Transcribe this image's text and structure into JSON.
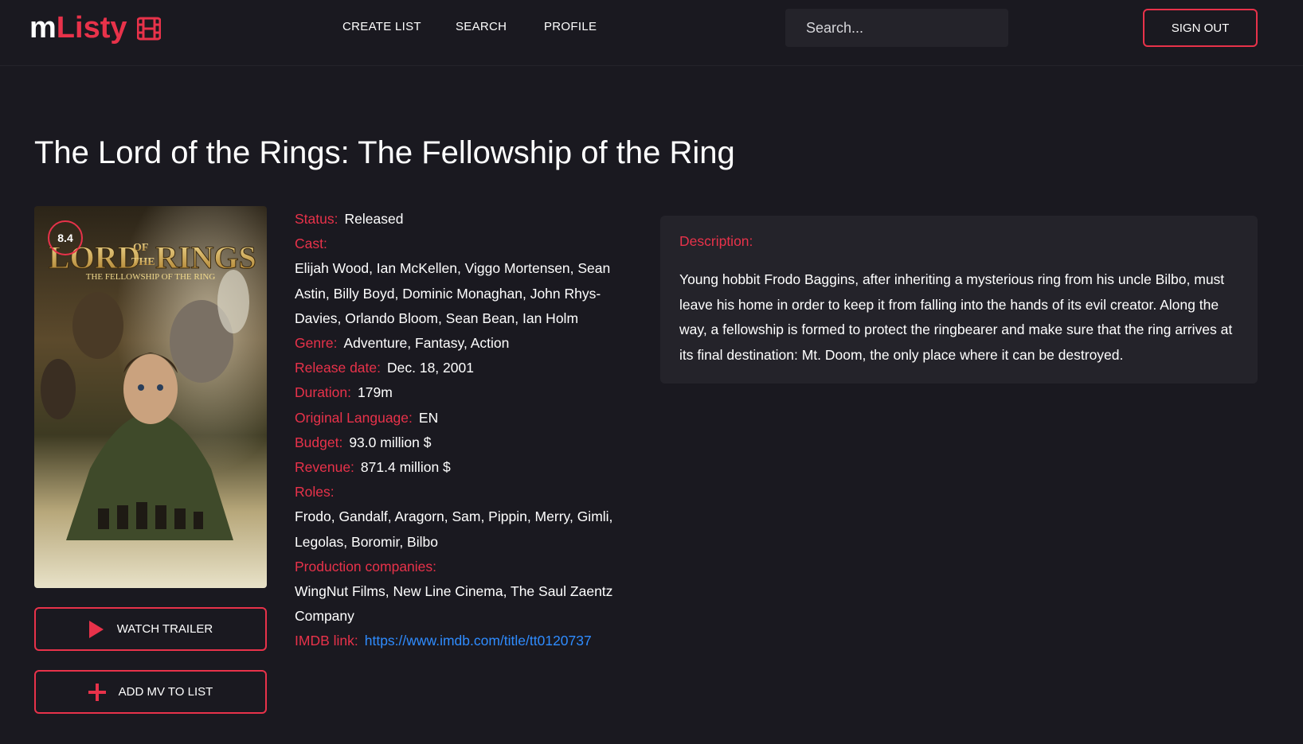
{
  "app": {
    "logo_prefix": "m",
    "logo_name": "Listy",
    "logo_icon": "film-icon"
  },
  "nav": {
    "items": [
      {
        "label": "CREATE LIST"
      },
      {
        "label": "SEARCH"
      },
      {
        "label": "PROFILE"
      }
    ],
    "search_placeholder": "Search...",
    "signout_label": "SIGN OUT"
  },
  "movie": {
    "title": "The Lord of the Rings: The Fellowship of the Ring",
    "rating": "8.4",
    "poster": {
      "title_line1": "LORD",
      "title_of": "OF",
      "title_the": "THE",
      "title_line2": "RINGS",
      "subtitle": "THE FELLOWSHIP OF THE RING"
    },
    "status_label": "Status:",
    "status": "Released",
    "cast_label": "Cast:",
    "cast": "Elijah Wood, Ian McKellen, Viggo Mortensen, Sean Astin, Billy Boyd, Dominic Monaghan, John Rhys-Davies, Orlando Bloom, Sean Bean, Ian Holm",
    "genre_label": "Genre:",
    "genre": "Adventure, Fantasy, Action",
    "release_label": "Release date:",
    "release_date": "Dec. 18, 2001",
    "duration_label": "Duration:",
    "duration": "179m",
    "language_label": "Original Language:",
    "language": "EN",
    "budget_label": "Budget:",
    "budget": "93.0 million $",
    "revenue_label": "Revenue:",
    "revenue": "871.4 million $",
    "roles_label": "Roles:",
    "roles": "Frodo, Gandalf, Aragorn, Sam, Pippin, Merry, Gimli, Legolas, Boromir, Bilbo",
    "companies_label": "Production companies:",
    "companies": "WingNut Films, New Line Cinema, The Saul Zaentz Company",
    "imdb_label": "IMDB link:",
    "imdb_url": "https://www.imdb.com/title/tt0120737",
    "description_label": "Description:",
    "description": "Young hobbit Frodo Baggins, after inheriting a mysterious ring from his uncle Bilbo, must leave his home in order to keep it from falling into the hands of its evil creator. Along the way, a fellowship is formed to protect the ringbearer and make sure that the ring arrives at its final destination: Mt. Doom, the only place where it can be destroyed."
  },
  "actions": {
    "trailer_label": "WATCH TRAILER",
    "trailer_icon": "play-icon",
    "add_label": "ADD MV TO LIST",
    "add_icon": "plus-icon"
  },
  "colors": {
    "accent": "#e8324a",
    "background": "#1a1920",
    "panel": "#24232a",
    "link": "#2f8cff"
  }
}
